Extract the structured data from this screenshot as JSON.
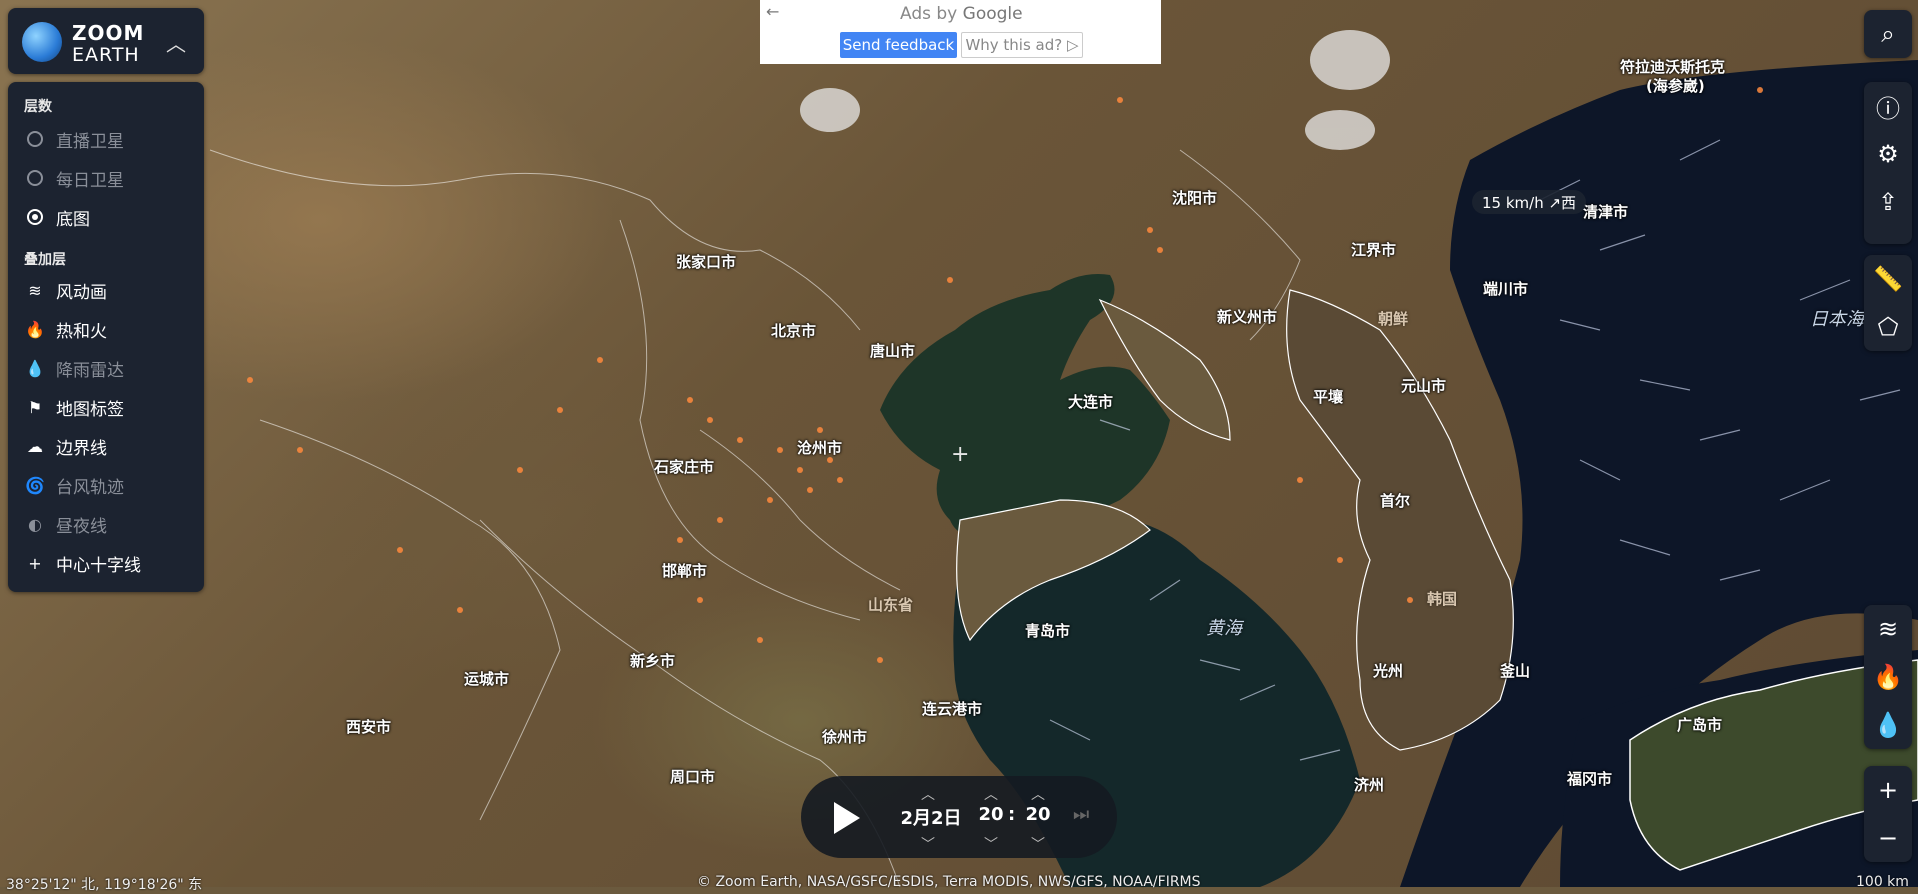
{
  "logo": {
    "line1": "ZOOM",
    "line2": "EARTH"
  },
  "layers_panel": {
    "base_title": "层数",
    "base_layers": [
      {
        "label": "直播卫星",
        "selected": false,
        "enabled": false
      },
      {
        "label": "每日卫星",
        "selected": false,
        "enabled": false
      },
      {
        "label": "底图",
        "selected": true,
        "enabled": true
      }
    ],
    "overlay_title": "叠加层",
    "overlays": [
      {
        "label": "风动画",
        "icon": "wind-icon",
        "enabled": true
      },
      {
        "label": "热和火",
        "icon": "fire-icon",
        "enabled": true
      },
      {
        "label": "降雨雷达",
        "icon": "raindrop-icon",
        "enabled": false
      },
      {
        "label": "地图标签",
        "icon": "flag-icon",
        "enabled": true
      },
      {
        "label": "边界线",
        "icon": "boundary-icon",
        "enabled": true
      },
      {
        "label": "台风轨迹",
        "icon": "typhoon-icon",
        "enabled": false
      },
      {
        "label": "昼夜线",
        "icon": "day-night-icon",
        "enabled": false
      },
      {
        "label": "中心十字线",
        "icon": "plus-icon",
        "enabled": true
      }
    ]
  },
  "ad": {
    "ads_by": "Ads by",
    "google": "Google",
    "send_feedback": "Send feedback",
    "why_this_ad": "Why this ad?"
  },
  "wind_tooltip": "15 km/h ↗西",
  "cities": {
    "shenyang": "沈阳市",
    "zhangjiakou": "张家口市",
    "beijing": "北京市",
    "tangshan": "唐山市",
    "dalian": "大连市",
    "cangzhou": "沧州市",
    "shijiazhuang": "石家庄市",
    "handan": "邯郸市",
    "qingdao": "青岛市",
    "xinxiang": "新乡市",
    "yuncheng": "运城市",
    "xian": "西安市",
    "lianyungang": "连云港市",
    "xuzhou": "徐州市",
    "zhoukou": "周口市",
    "jiangjie": "江界市",
    "sinuiju": "新义州市",
    "pyongyang": "平壤",
    "wonsan": "元山市",
    "seoul": "首尔",
    "gwangju": "光州",
    "busan": "釜山",
    "jeju": "济州",
    "fukuoka": "福冈市",
    "hiroshima": "广岛市",
    "duanchuan": "端川市",
    "vladivostok": "符拉迪沃斯托克",
    "vladivostok_alt": "(海参崴)",
    "qingjin": "清津市"
  },
  "regions": {
    "korea_north": "朝鲜",
    "korea_south": "韩国",
    "shandong": "山东省"
  },
  "seas": {
    "yellow_sea": "黄海",
    "sea_of_japan": "日本海"
  },
  "timeline": {
    "date": "2月2日",
    "hour": "20",
    "minute": "20"
  },
  "coordinates": "38°25'12\" 北, 119°18'26\" 东",
  "attribution": "© Zoom Earth, NASA/GSFC/ESDIS, Terra MODIS, NWS/GFS, NOAA/FIRMS",
  "scale_label": "100 km"
}
